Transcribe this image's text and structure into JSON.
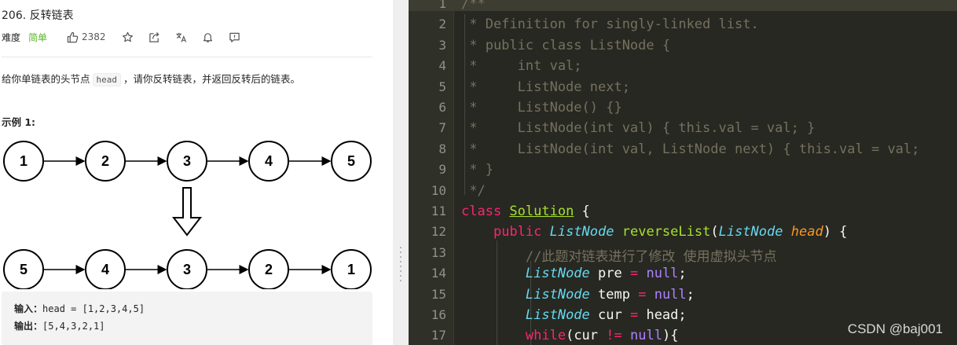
{
  "problem": {
    "title": "206. 反转链表",
    "difficulty_label": "难度",
    "difficulty": "简单",
    "likes": "2382",
    "description_pre": "给你单链表的头节点",
    "description_code": "head",
    "description_post": "，请你反转链表，并返回反转后的链表。",
    "example_title": "示例 1:",
    "input_label": "输入：",
    "input_value": "head = [1,2,3,4,5]",
    "output_label": "输出：",
    "output_value": "[5,4,3,2,1]",
    "diagram_top": [
      "1",
      "2",
      "3",
      "4",
      "5"
    ],
    "diagram_bottom": [
      "5",
      "4",
      "3",
      "2",
      "1"
    ]
  },
  "toolbar_icons": [
    "thumbs-up-icon",
    "star-icon",
    "share-icon",
    "translate-icon",
    "bell-icon",
    "feedback-icon"
  ],
  "editor": {
    "line_numbers": [
      "1",
      "2",
      "3",
      "4",
      "5",
      "6",
      "7",
      "8",
      "9",
      "10",
      "11",
      "12",
      "13",
      "14",
      "15",
      "16",
      "17"
    ],
    "lines": [
      [
        {
          "t": "/**",
          "c": "cm"
        }
      ],
      [
        {
          "t": " * Definition for singly-linked list.",
          "c": "cm"
        }
      ],
      [
        {
          "t": " * public class ListNode {",
          "c": "cm"
        }
      ],
      [
        {
          "t": " *     int val;",
          "c": "cm"
        }
      ],
      [
        {
          "t": " *     ListNode next;",
          "c": "cm"
        }
      ],
      [
        {
          "t": " *     ListNode() {}",
          "c": "cm"
        }
      ],
      [
        {
          "t": " *     ListNode(int val) { this.val = val; }",
          "c": "cm"
        }
      ],
      [
        {
          "t": " *     ListNode(int val, ListNode next) { this.val = val;",
          "c": "cm"
        }
      ],
      [
        {
          "t": " * }",
          "c": "cm"
        }
      ],
      [
        {
          "t": " */",
          "c": "cm"
        }
      ],
      [
        {
          "t": "class ",
          "c": "kw"
        },
        {
          "t": "Solution",
          "c": "cls"
        },
        {
          "t": " {",
          "c": "pl"
        }
      ],
      [
        {
          "t": "    ",
          "c": "pl"
        },
        {
          "t": "public ",
          "c": "kw"
        },
        {
          "t": "ListNode",
          "c": "ty"
        },
        {
          "t": " ",
          "c": "pl"
        },
        {
          "t": "reverseList",
          "c": "fn"
        },
        {
          "t": "(",
          "c": "pl"
        },
        {
          "t": "ListNode",
          "c": "ty"
        },
        {
          "t": " ",
          "c": "pl"
        },
        {
          "t": "head",
          "c": "pa"
        },
        {
          "t": ") {",
          "c": "pl"
        }
      ],
      [
        {
          "t": "        ",
          "c": "pl"
        },
        {
          "t": "//此题对链表进行了修改 使用虚拟头节点",
          "c": "cm"
        }
      ],
      [
        {
          "t": "        ",
          "c": "pl"
        },
        {
          "t": "ListNode",
          "c": "ty"
        },
        {
          "t": " pre ",
          "c": "pl"
        },
        {
          "t": "=",
          "c": "kw"
        },
        {
          "t": " ",
          "c": "pl"
        },
        {
          "t": "null",
          "c": "nu"
        },
        {
          "t": ";",
          "c": "pl"
        }
      ],
      [
        {
          "t": "        ",
          "c": "pl"
        },
        {
          "t": "ListNode",
          "c": "ty"
        },
        {
          "t": " temp ",
          "c": "pl"
        },
        {
          "t": "=",
          "c": "kw"
        },
        {
          "t": " ",
          "c": "pl"
        },
        {
          "t": "null",
          "c": "nu"
        },
        {
          "t": ";",
          "c": "pl"
        }
      ],
      [
        {
          "t": "        ",
          "c": "pl"
        },
        {
          "t": "ListNode",
          "c": "ty"
        },
        {
          "t": " cur ",
          "c": "pl"
        },
        {
          "t": "=",
          "c": "kw"
        },
        {
          "t": " head;",
          "c": "pl"
        }
      ],
      [
        {
          "t": "        ",
          "c": "pl"
        },
        {
          "t": "while",
          "c": "kw"
        },
        {
          "t": "(cur ",
          "c": "pl"
        },
        {
          "t": "!=",
          "c": "kw"
        },
        {
          "t": " ",
          "c": "pl"
        },
        {
          "t": "null",
          "c": "nu"
        },
        {
          "t": "){",
          "c": "pl"
        }
      ]
    ],
    "watermark": "CSDN @baj001"
  },
  "colors": {
    "editor_bg": "#272822",
    "keyword": "#f92672",
    "type": "#66d9ef",
    "function": "#a6e22e",
    "param": "#fd971f",
    "number": "#ae81ff",
    "comment": "#75715e",
    "difficulty_easy": "#5ab726"
  }
}
